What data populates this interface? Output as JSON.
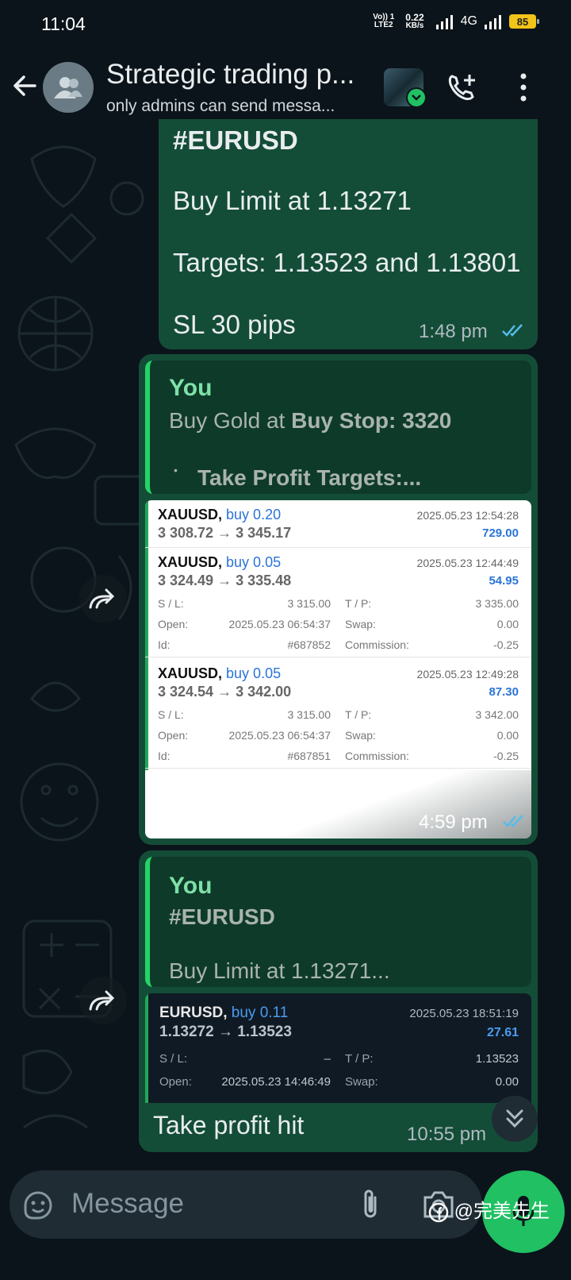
{
  "status_bar": {
    "time": "11:04",
    "volte": "Vo)) 1",
    "lte": "LTE2",
    "speed_value": "0.22",
    "speed_unit": "KB/s",
    "network": "4G",
    "battery": "85"
  },
  "header": {
    "title": "Strategic trading p...",
    "subtitle": "only admins can send messa..."
  },
  "messages": {
    "m1": {
      "lines": [
        "#EURUSD",
        "Buy Limit at 1.13271",
        "Targets: 1.13523 and 1.13801",
        "SL 30 pips"
      ],
      "time": "1:48 pm"
    },
    "m2": {
      "quote_author": "You",
      "quote_line1_plain": "Buy Gold at ",
      "quote_line1_bold": "Buy Stop: 3320",
      "quote_line2": "Take Profit Targets:...",
      "time": "4:59 pm",
      "trades": [
        {
          "symbol": "XAUUSD,",
          "side": "buy 0.20",
          "prices": "3 308.72 → 3 345.17",
          "time": "2025.05.23 12:54:28",
          "profit": "729.00"
        },
        {
          "symbol": "XAUUSD,",
          "side": "buy 0.05",
          "prices": "3 324.49 → 3 335.48",
          "time": "2025.05.23 12:44:49",
          "profit": "54.95",
          "sl_label": "S / L:",
          "sl": "3 315.00",
          "tp_label": "T / P:",
          "tp": "3 335.00",
          "open_label": "Open:",
          "open": "2025.05.23 06:54:37",
          "swap_label": "Swap:",
          "swap": "0.00",
          "id_label": "Id:",
          "id": "#687852",
          "comm_label": "Commission:",
          "comm": "-0.25"
        },
        {
          "symbol": "XAUUSD,",
          "side": "buy 0.05",
          "prices": "3 324.54 → 3 342.00",
          "time": "2025.05.23 12:49:28",
          "profit": "87.30",
          "sl_label": "S / L:",
          "sl": "3 315.00",
          "tp_label": "T / P:",
          "tp": "3 342.00",
          "open_label": "Open:",
          "open": "2025.05.23 06:54:37",
          "swap_label": "Swap:",
          "swap": "0.00",
          "id_label": "Id:",
          "id": "#687851",
          "comm_label": "Commission:",
          "comm": "-0.25"
        }
      ]
    },
    "m3": {
      "quote_author": "You",
      "quote_line1": "#EURUSD",
      "quote_line2": "Buy Limit at 1.13271...",
      "trade": {
        "symbol": "EURUSD,",
        "side": "buy 0.11",
        "prices": "1.13272 → 1.13523",
        "time": "2025.05.23 18:51:19",
        "profit": "27.61",
        "sl_label": "S / L:",
        "sl": "–",
        "tp_label": "T / P:",
        "tp": "1.13523",
        "open_label": "Open:",
        "open": "2025.05.23 14:46:49",
        "swap_label": "Swap:",
        "swap": "0.00"
      },
      "text": "Take profit hit",
      "time": "10:55 pm"
    }
  },
  "composer": {
    "placeholder": "Message"
  },
  "watermark": "@完美先生",
  "colors": {
    "background": "#0b141a",
    "bubble": "#144d37",
    "accent": "#21c063",
    "ticks": "#53bdeb"
  }
}
